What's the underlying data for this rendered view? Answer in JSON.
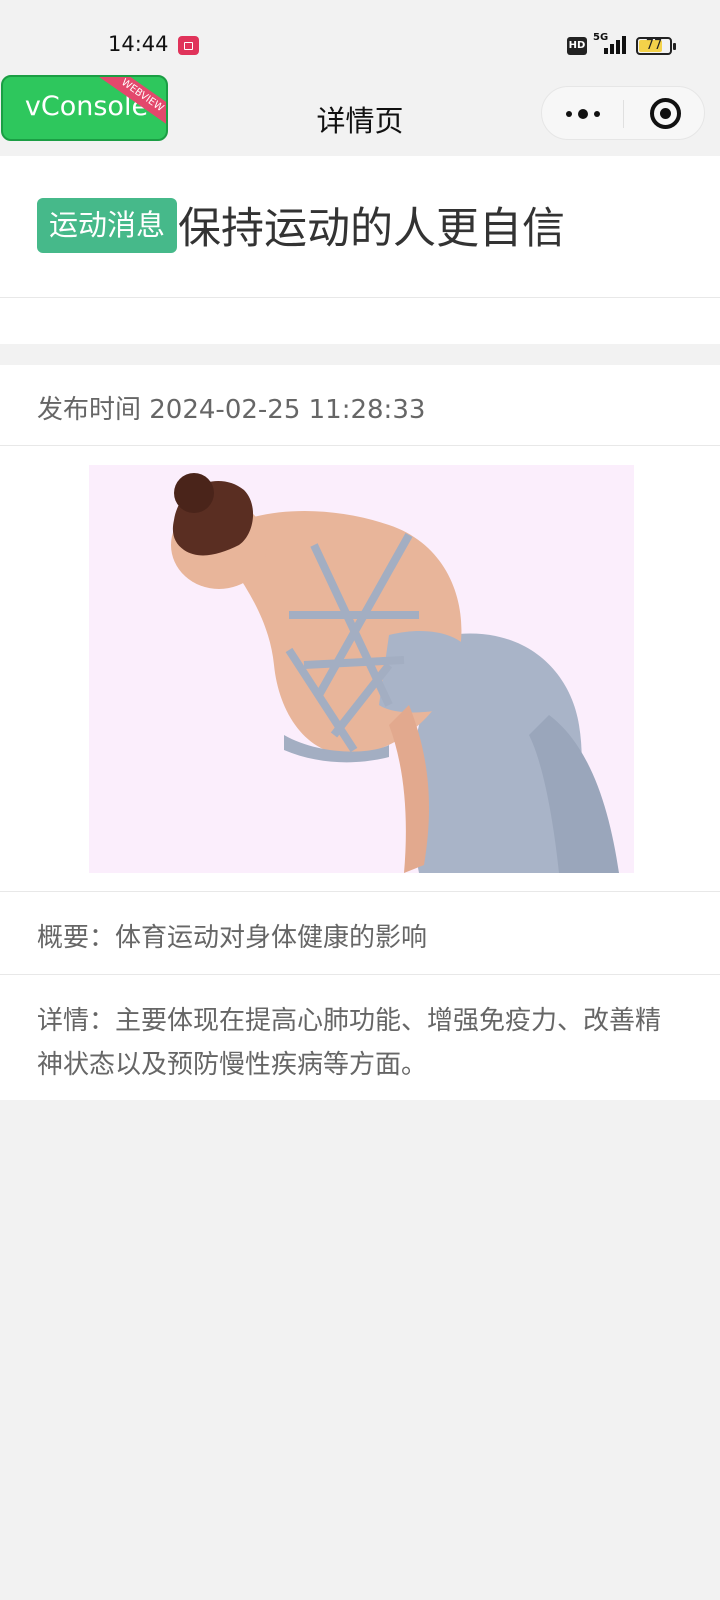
{
  "status_bar": {
    "time": "14:44",
    "hd_label": "HD",
    "network_label": "5G",
    "battery_level": "77",
    "battery_percent": 77,
    "icons": [
      "screen-record-icon",
      "hd-icon",
      "signal-icon",
      "battery-icon"
    ]
  },
  "vconsole": {
    "label": "vConsole",
    "ribbon": "WEBVIEW",
    "color": "#2ec75d"
  },
  "nav": {
    "title": "详情页",
    "icons": [
      "more-icon",
      "close-target-icon"
    ]
  },
  "article": {
    "category": "运动消息",
    "category_color": "#46b98a",
    "title": "保持运动的人更自信",
    "publish_time": "发布时间 2024-02-25 11:28:33",
    "summary": "概要：体育运动对身体健康的影响",
    "detail": "详情：主要体现在提高心肺功能、增强免疫力、改善精神状态以及预防慢性疾病等方面。"
  }
}
